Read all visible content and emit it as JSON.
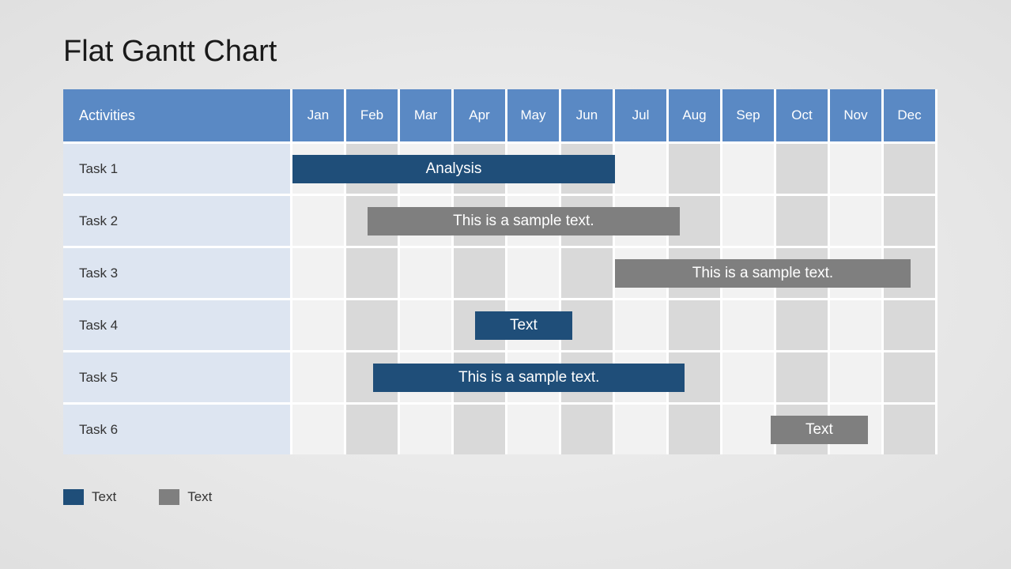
{
  "title": "Flat Gantt Chart",
  "header": {
    "activities": "Activities",
    "months": [
      "Jan",
      "Feb",
      "Mar",
      "Apr",
      "May",
      "Jun",
      "Jul",
      "Aug",
      "Sep",
      "Oct",
      "Nov",
      "Dec"
    ]
  },
  "tasks": [
    {
      "name": "Task 1"
    },
    {
      "name": "Task 2"
    },
    {
      "name": "Task 3"
    },
    {
      "name": "Task 4"
    },
    {
      "name": "Task 5"
    },
    {
      "name": "Task 6"
    }
  ],
  "bars": [
    {
      "label": "Analysis",
      "row": 0,
      "start": 0,
      "span": 6,
      "color": "blue"
    },
    {
      "label": "This is a sample text.",
      "row": 1,
      "start": 1.4,
      "span": 5.8,
      "color": "gray"
    },
    {
      "label": "This is a sample text.",
      "row": 2,
      "start": 6,
      "span": 5.5,
      "color": "gray"
    },
    {
      "label": "Text",
      "row": 3,
      "start": 3.4,
      "span": 1.8,
      "color": "blue"
    },
    {
      "label": "This is a sample text.",
      "row": 4,
      "start": 1.5,
      "span": 5.8,
      "color": "blue"
    },
    {
      "label": "Text",
      "row": 5,
      "start": 8.9,
      "span": 1.8,
      "color": "gray"
    }
  ],
  "legend": [
    {
      "color": "blue",
      "label": "Text"
    },
    {
      "color": "gray",
      "label": "Text"
    }
  ],
  "chart_data": {
    "type": "bar",
    "title": "Flat Gantt Chart",
    "xlabel": "",
    "ylabel": "",
    "categories": [
      "Jan",
      "Feb",
      "Mar",
      "Apr",
      "May",
      "Jun",
      "Jul",
      "Aug",
      "Sep",
      "Oct",
      "Nov",
      "Dec"
    ],
    "series": [
      {
        "name": "Task 1",
        "start_month": "Jan",
        "end_month": "Jun",
        "label": "Analysis",
        "category": "blue"
      },
      {
        "name": "Task 2",
        "start_month": "Feb",
        "end_month": "Jul",
        "label": "This is a sample text.",
        "category": "gray"
      },
      {
        "name": "Task 3",
        "start_month": "Jul",
        "end_month": "Nov",
        "label": "This is a sample text.",
        "category": "gray"
      },
      {
        "name": "Task 4",
        "start_month": "Apr",
        "end_month": "May",
        "label": "Text",
        "category": "blue"
      },
      {
        "name": "Task 5",
        "start_month": "Feb",
        "end_month": "Jul",
        "label": "This is a sample text.",
        "category": "blue"
      },
      {
        "name": "Task 6",
        "start_month": "Sep",
        "end_month": "Oct",
        "label": "Text",
        "category": "gray"
      }
    ],
    "legend": [
      "Text",
      "Text"
    ]
  }
}
